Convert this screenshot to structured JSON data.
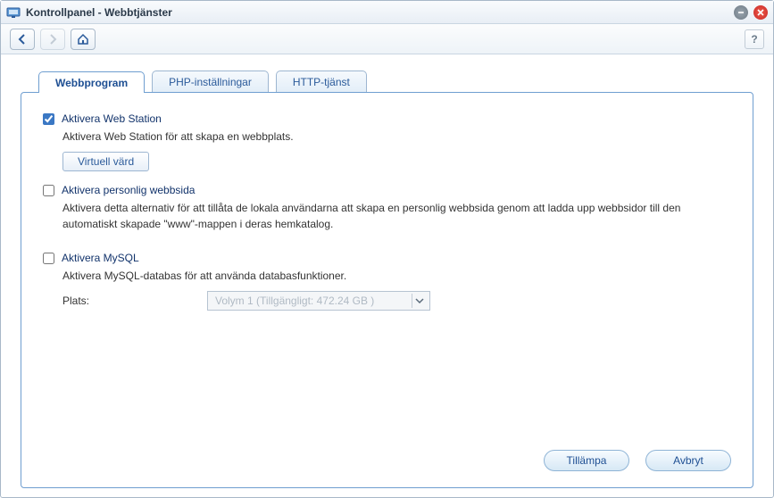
{
  "window": {
    "title": "Kontrollpanel - Webbtjänster"
  },
  "toolbar": {
    "back_tip": "Tillbaka",
    "forward_tip": "Framåt",
    "home_tip": "Hem",
    "help_label": "?"
  },
  "tabs": [
    {
      "label": "Webbprogram",
      "active": true
    },
    {
      "label": "PHP-inställningar",
      "active": false
    },
    {
      "label": "HTTP-tjänst",
      "active": false
    }
  ],
  "webstation": {
    "enable_label": "Aktivera Web Station",
    "enable_checked": true,
    "desc": "Aktivera Web Station för att skapa en webbplats.",
    "virtual_host_button": "Virtuell värd"
  },
  "personal": {
    "enable_label": "Aktivera personlig webbsida",
    "enable_checked": false,
    "desc": "Aktivera detta alternativ för att tillåta de lokala användarna att skapa en personlig webbsida genom att ladda upp webbsidor till den automatiskt skapade \"www\"-mappen i deras hemkatalog."
  },
  "mysql": {
    "enable_label": "Aktivera MySQL",
    "enable_checked": false,
    "desc": "Aktivera MySQL-databas för att använda databasfunktioner.",
    "location_label": "Plats:",
    "location_value": "Volym 1 (Tillgängligt: 472.24 GB )",
    "location_disabled": true
  },
  "footer": {
    "apply": "Tillämpa",
    "cancel": "Avbryt"
  }
}
